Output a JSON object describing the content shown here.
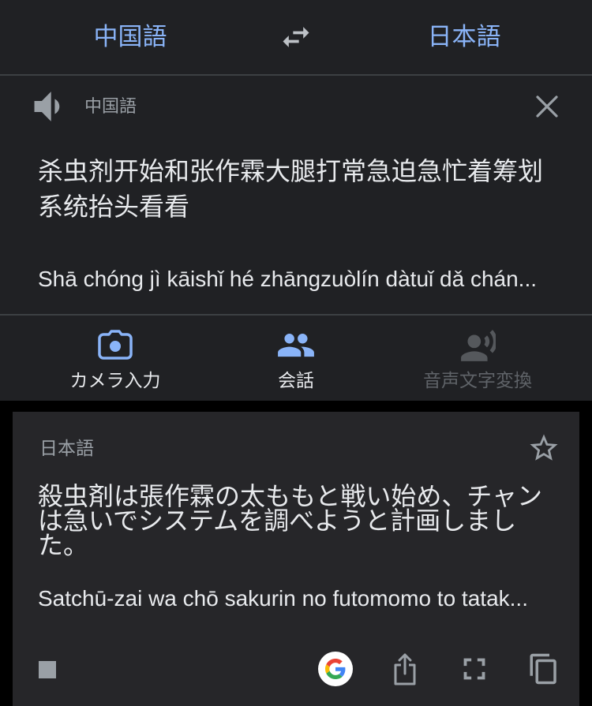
{
  "header": {
    "source_lang": "中国語",
    "target_lang": "日本語",
    "swap_icon": "swap-arrows-icon"
  },
  "source": {
    "lang_label": "中国語",
    "text": "杀虫剂开始和张作霖大腿打常急迫急忙着筹划系统抬头看看",
    "romanization": "Shā chóng jì kāishǐ hé zhāngzuòlín dàtuǐ dǎ chán...",
    "speaker_icon": "speaker-icon",
    "close_icon": "close-icon"
  },
  "actions": [
    {
      "label": "カメラ入力",
      "icon": "camera-icon",
      "enabled": true
    },
    {
      "label": "会話",
      "icon": "conversation-icon",
      "enabled": true
    },
    {
      "label": "音声文字変換",
      "icon": "voice-transcribe-icon",
      "enabled": false
    }
  ],
  "result": {
    "lang_label": "日本語",
    "text": "殺虫剤は張作霖の太ももと戦い始め、チャンは急いでシステムを調べようと計画しました。",
    "romanization": "Satchū-zai wa chō sakurin no futomomo to tatak...",
    "icons": [
      "star-icon",
      "stop-icon",
      "google-logo-icon",
      "share-icon",
      "fullscreen-icon",
      "copy-icon"
    ]
  },
  "colors": {
    "accent": "#8ab4f8",
    "text": "#e8eaed",
    "muted": "#9aa0a6",
    "disabled": "#5f6368",
    "surface": "#202124",
    "card": "#262629",
    "background": "#000000"
  }
}
